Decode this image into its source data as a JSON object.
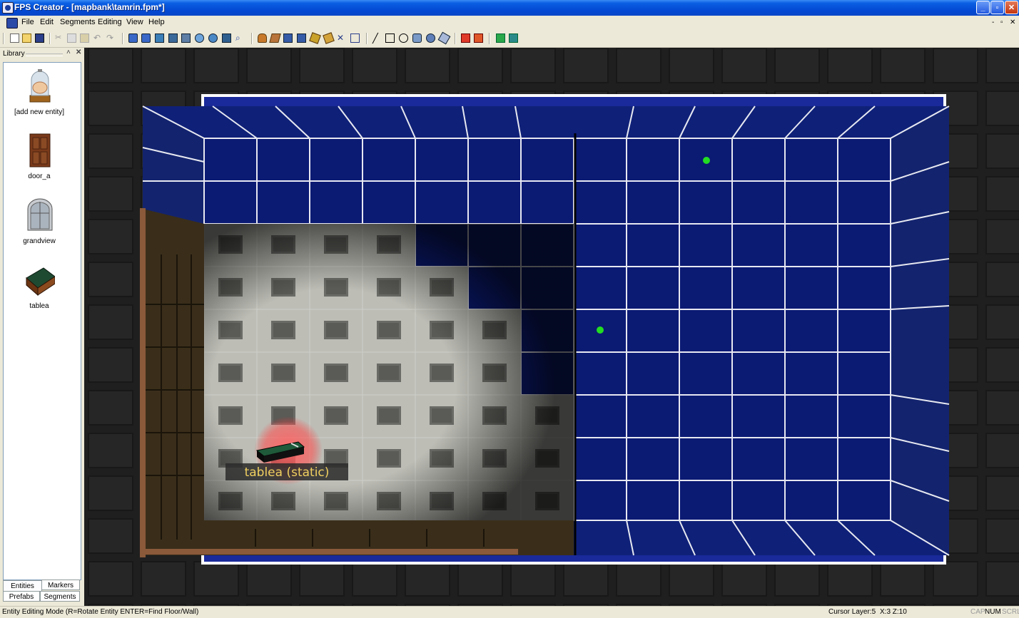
{
  "window": {
    "title": "FPS Creator - [mapbank\\tamrin.fpm*]",
    "buttons": {
      "minimize": "_",
      "restore": "▫",
      "close": "✕"
    }
  },
  "menu": {
    "items": [
      "File",
      "Edit",
      "Segments",
      "Editing",
      "View",
      "Help"
    ],
    "mdi_controls": [
      "-",
      "▫",
      "✕"
    ]
  },
  "library": {
    "title": "Library",
    "entities": [
      {
        "label": "[add new entity]",
        "icon": "brain-jar-icon"
      },
      {
        "label": "door_a",
        "icon": "door-icon"
      },
      {
        "label": "grandview",
        "icon": "window-icon"
      },
      {
        "label": "tablea",
        "icon": "table-icon"
      }
    ],
    "tabs": [
      "Entities",
      "Markers",
      "Prefabs",
      "Segments"
    ]
  },
  "viewport": {
    "selected_label": "tablea (static)",
    "colors": {
      "floor_blue": "#0b1a73",
      "grid_line": "#ffffff",
      "marker_green": "#22dd22",
      "selection_glow": "#ff5050",
      "label_text": "#f0d060"
    }
  },
  "status": {
    "mode": "Entity Editing Mode (R=Rotate Entity  ENTER=Find Floor/Wall)",
    "cursor_layer": "Cursor Layer:5",
    "coords": "X:3  Z:10",
    "caps": "CAP",
    "num": "NUM",
    "scrl": "SCRL"
  }
}
